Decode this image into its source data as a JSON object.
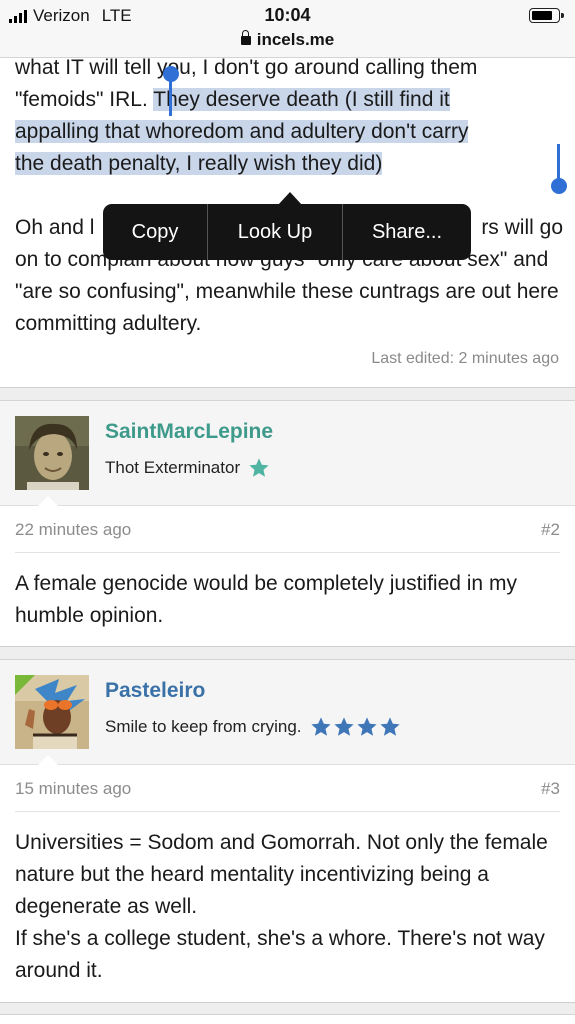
{
  "status_bar": {
    "carrier": "Verizon",
    "network": "LTE",
    "time": "10:04",
    "url": "incels.me"
  },
  "post1": {
    "line1": "what IT will tell you, I don't go around calling them",
    "line2_pre": "\"femoids\" IRL. ",
    "line2_sel": "They deserve death (I still find it",
    "line3_sel": "appalling that whoredom and adultery don't carry",
    "line4_sel": "the death penalty, I really wish they did)",
    "para2_line1_start": "Oh and l",
    "para2_line1_end": "rs will go",
    "para2_rest": "on to complain about how guys \"only care about sex\" and \"are so confusing\", meanwhile these cuntrags are out here committing adultery.",
    "last_edited": "Last edited: 2 minutes ago"
  },
  "context_menu": {
    "copy": "Copy",
    "look_up": "Look Up",
    "share": "Share..."
  },
  "post2": {
    "username": "SaintMarcLepine",
    "user_title": "Thot Exterminator",
    "username_color": "#3e9a8a",
    "star_color": "#4fb5a2",
    "star_count": 1,
    "time": "22 minutes ago",
    "number": "#2",
    "body": "A female genocide would be completely justified in my humble opinion."
  },
  "post3": {
    "username": "Pasteleiro",
    "user_title": "Smile to keep from crying.",
    "username_color": "#3a72a8",
    "star_color": "#3f76b8",
    "star_count": 4,
    "time": "15 minutes ago",
    "number": "#3",
    "body_line1": "Universities = Sodom and Gomorrah. Not only the female nature but the heard mentality incentivizing being a degenerate as well.",
    "body_line2": "If she's a college student, she's a whore. There's not way around it."
  }
}
